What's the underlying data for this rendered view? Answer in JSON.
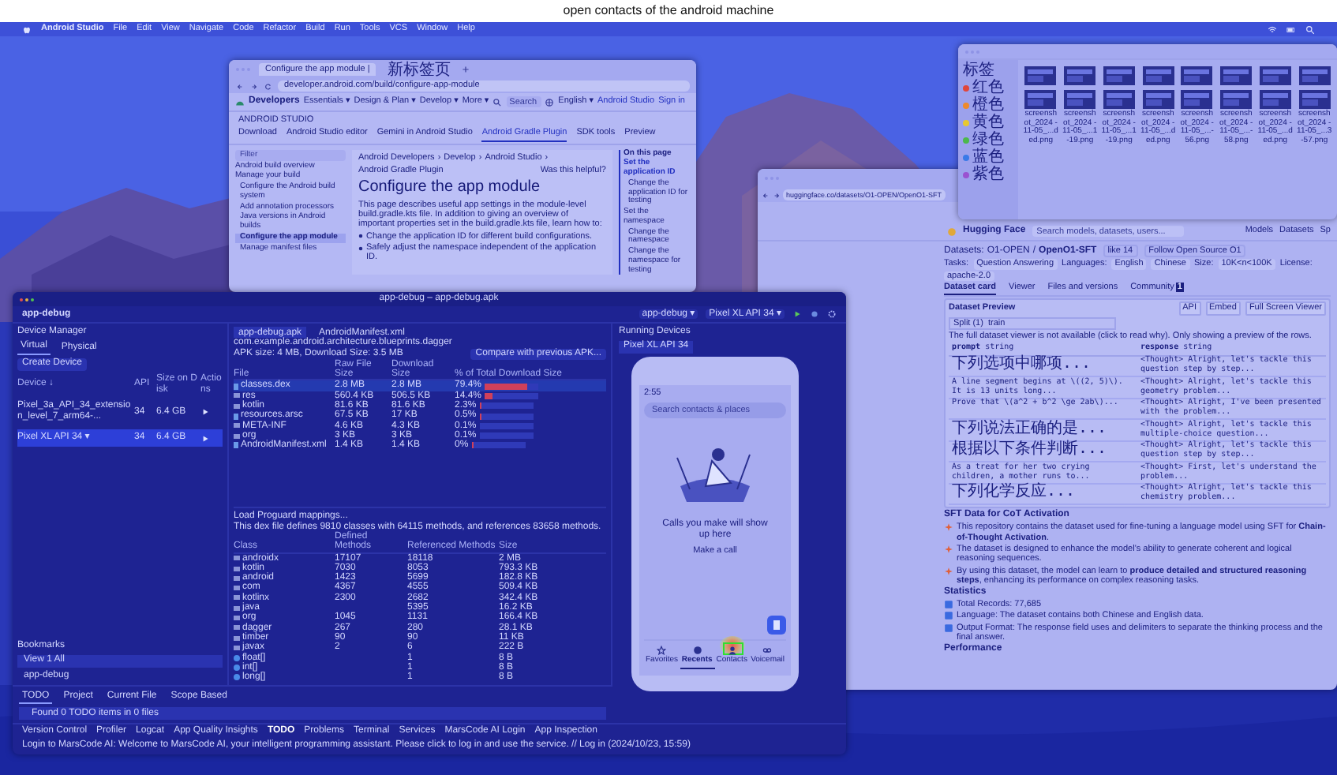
{
  "caption": "open contacts of the android machine",
  "menubar": {
    "app": "Android Studio",
    "items": [
      "File",
      "Edit",
      "View",
      "Navigate",
      "Code",
      "Refactor",
      "Build",
      "Run",
      "Tools",
      "VCS",
      "Window",
      "Help"
    ]
  },
  "dev": {
    "tabs": [
      {
        "label": "Configure the app module |",
        "selected": true
      },
      {
        "label": "新标签页",
        "selected": false
      }
    ],
    "url": "developer.android.com/build/configure-app-module",
    "brand": "Developers",
    "nav": [
      "Essentials ▾",
      "Design & Plan ▾",
      "Develop ▾",
      "More ▾"
    ],
    "search": {
      "placeholder": "Search"
    },
    "language": "English ▾",
    "actions": [
      "Android Studio",
      "Sign in"
    ],
    "section": "ANDROID STUDIO",
    "subtabs": [
      {
        "label": "Download",
        "selected": false
      },
      {
        "label": "Android Studio editor",
        "selected": false
      },
      {
        "label": "Gemini in Android Studio",
        "selected": false
      },
      {
        "label": "Android Gradle Plugin",
        "selected": true
      },
      {
        "label": "SDK tools",
        "selected": false
      },
      {
        "label": "Preview",
        "selected": false
      }
    ],
    "filter": {
      "placeholder": "Filter"
    },
    "sidebar": [
      {
        "label": "Android build overview",
        "kind": "section",
        "selected": false
      },
      {
        "label": "Manage your build",
        "kind": "section",
        "selected": false
      },
      {
        "label": "Configure the Android build system",
        "kind": "page",
        "selected": false
      },
      {
        "label": "Add annotation processors",
        "kind": "page",
        "selected": false
      },
      {
        "label": "Java versions in Android builds",
        "kind": "page",
        "selected": false
      },
      {
        "label": "Configure the app module",
        "kind": "page",
        "selected": true
      },
      {
        "label": "Manage manifest files",
        "kind": "page",
        "selected": false
      }
    ],
    "breadcrumb": [
      "Android Developers",
      "›",
      "Develop",
      "›",
      "Android Studio",
      "›",
      "Android Gradle Plugin"
    ],
    "helpful": "Was this helpful?",
    "title": "Configure the app module",
    "intro": "This page describes useful app settings in the module-level build.gradle.kts file. In addition to giving an overview of important properties set in the build.gradle.kts file, learn how to:",
    "bullets": [
      "Change the application ID for different build configurations.",
      "Safely adjust the namespace independent of the application ID."
    ],
    "toc_title": "On this page",
    "toc": [
      {
        "label": "Set the application ID",
        "kind": "section",
        "selected": true
      },
      {
        "label": "Change the application ID for testing",
        "kind": "sub",
        "selected": false
      },
      {
        "label": "Set the namespace",
        "kind": "section",
        "selected": false
      },
      {
        "label": "Change the namespace",
        "kind": "sub",
        "selected": false
      },
      {
        "label": "Change the namespace for testing",
        "kind": "sub",
        "selected": false
      }
    ]
  },
  "finder": {
    "tags_header": "标签",
    "tags": [
      {
        "label": "红色",
        "color": "#e0463c"
      },
      {
        "label": "橙色",
        "color": "#ee8a2c"
      },
      {
        "label": "黄色",
        "color": "#e8c830"
      },
      {
        "label": "绿色",
        "color": "#4cb84c"
      },
      {
        "label": "蓝色",
        "color": "#3a7ae8"
      },
      {
        "label": "紫色",
        "color": "#9a52d0"
      }
    ],
    "files": [
      "screenshot_2024 -11-05_...ded.png",
      "screenshot_2024 -11-05_...1-19.png",
      "screenshot_2024 -11-05_...1-19.png",
      "screenshot_2024 -11-05_...ded.png",
      "screenshot_2024 -11-05_...-56.png",
      "screenshot_2024 -11-05_...-58.png",
      "screenshot_2024 -11-05_...ded.png",
      "screenshot_2024 -11-05_...3-57.png"
    ]
  },
  "hf": {
    "url": "huggingface.co/datasets/O1-OPEN/OpenO1-SFT",
    "brand": "Hugging Face",
    "search": {
      "placeholder": "Search models, datasets, users..."
    },
    "nav": [
      "Models",
      "Datasets",
      "Sp"
    ],
    "crumb": [
      "Datasets:",
      "O1-OPEN",
      "/",
      "OpenO1-SFT"
    ],
    "like": "like",
    "likes": "14",
    "follow": "Follow",
    "follow_org": "Open Source O1",
    "meta": [
      {
        "label": "Tasks:",
        "values": [
          "Question Answering"
        ]
      },
      {
        "label": "Languages:",
        "values": [
          "English",
          "Chinese"
        ]
      },
      {
        "label": "Size:",
        "values": [
          "10K<n<100K"
        ]
      },
      {
        "label": "License:",
        "values": [
          "apache-2.0"
        ]
      }
    ],
    "tabs": [
      {
        "label": "Dataset card",
        "selected": true
      },
      {
        "label": "Viewer",
        "selected": false
      },
      {
        "label": "Files and versions",
        "selected": false
      },
      {
        "label": "Community",
        "selected": false,
        "badge": "1"
      }
    ],
    "preview": {
      "title": "Dataset Preview",
      "actions": [
        "API",
        "Embed",
        "Full Screen Viewer"
      ],
      "split_label": "Split (1)",
      "split": "train",
      "notice": "The full dataset viewer is not available (click to read why). Only showing a preview of the rows.",
      "columns": [
        {
          "name": "prompt",
          "type": "string"
        },
        {
          "name": "response",
          "type": "string"
        }
      ],
      "rows": [
        {
          "kind": "cjk",
          "prompt": "下列选项中哪项...",
          "response": "<Thought> Alright, let's tackle this question step by step..."
        },
        {
          "kind": "latin",
          "prompt": "A line segment begins at \\((2, 5)\\). It is 13 units long...",
          "response": "<Thought> Alright, let's tackle this geometry problem..."
        },
        {
          "kind": "latin",
          "prompt": "Prove that \\(a^2 + b^2 \\ge 2ab\\)...",
          "response": "<Thought> Alright, I've been presented with the problem..."
        },
        {
          "kind": "cjk",
          "prompt": "下列说法正确的是...",
          "response": "<Thought> Alright, let's tackle this multiple-choice question..."
        },
        {
          "kind": "cjk",
          "prompt": "根据以下条件判断...",
          "response": "<Thought> Alright, let's tackle this question step by step..."
        },
        {
          "kind": "latin",
          "prompt": "As a treat for her two crying children, a mother runs to...",
          "response": "<Thought> First, let's understand the problem..."
        },
        {
          "kind": "cjk",
          "prompt": "下列化学反应...",
          "response": "<Thought> Alright, let's tackle this chemistry problem..."
        }
      ]
    },
    "heading": "SFT Data for CoT Activation",
    "paragraphs": [
      "This repository contains the dataset used for fine-tuning a language model using SFT for **Chain-of-Thought Activation**.",
      "The dataset is designed to enhance the model's ability to generate coherent and logical reasoning sequences.",
      "By using this dataset, the model can learn to **produce detailed and structured reasoning steps**, enhancing its performance on complex reasoning tasks."
    ],
    "stats_heading": "Statistics",
    "stats": [
      "Total Records: 77,685",
      "Language: The dataset contains both Chinese and English data.",
      "Output Format: The response field uses and delimiters to separate the thinking process and the final answer."
    ],
    "perf_heading": "Performance"
  },
  "as": {
    "title": "app-debug – app-debug.apk",
    "project": "app-debug",
    "run_config": "app-debug ▾",
    "device": "Pixel XL API 34 ▾",
    "devmgr": {
      "title": "Device Manager",
      "tabs": [
        {
          "label": "Virtual",
          "selected": true
        },
        {
          "label": "Physical",
          "selected": false
        }
      ],
      "create": "Create Device",
      "columns": [
        "Device ↓",
        "API",
        "Size on Disk",
        "Actions"
      ],
      "rows": [
        {
          "name": "Pixel_3a_API_34_extension_level_7_arm64-...",
          "api": "34",
          "size": "6.4 GB",
          "selected": false
        },
        {
          "name": "Pixel XL API 34 ▾",
          "api": "34",
          "size": "6.4 GB",
          "selected": true
        }
      ]
    },
    "bookmarks": {
      "title": "Bookmarks",
      "items": [
        {
          "label": "View 1 All",
          "selected": true
        },
        {
          "label": "app-debug",
          "selected": false
        }
      ]
    },
    "apk": {
      "tabs": [
        {
          "label": "app-debug.apk",
          "selected": true
        },
        {
          "label": "AndroidManifest.xml",
          "selected": false
        }
      ],
      "package": "com.example.android.architecture.blueprints.dagger",
      "size": "APK size: 4 MB, Download Size: 3.5 MB",
      "compare": "Compare with previous APK...",
      "columns": [
        "File",
        "Raw File Size",
        "Download Size",
        "% of Total Download Size"
      ],
      "rows": [
        {
          "name": "classes.dex",
          "kind": "file",
          "raw": "2.8 MB",
          "download": "2.8 MB",
          "percent": "79.4%",
          "level": 0.794
        },
        {
          "name": "res",
          "kind": "folder",
          "raw": "560.4 KB",
          "download": "506.5 KB",
          "percent": "14.4%",
          "level": 0.144
        },
        {
          "name": "kotlin",
          "kind": "folder",
          "raw": "81.6 KB",
          "download": "81.6 KB",
          "percent": "2.3%",
          "level": 0.023
        },
        {
          "name": "resources.arsc",
          "kind": "file",
          "raw": "67.5 KB",
          "download": "17 KB",
          "percent": "0.5%",
          "level": 0.005
        },
        {
          "name": "META-INF",
          "kind": "folder",
          "raw": "4.6 KB",
          "download": "4.3 KB",
          "percent": "0.1%",
          "level": 0.001
        },
        {
          "name": "org",
          "kind": "folder",
          "raw": "3 KB",
          "download": "3 KB",
          "percent": "0.1%",
          "level": 0.001
        },
        {
          "name": "AndroidManifest.xml",
          "kind": "file",
          "raw": "1.4 KB",
          "download": "1.4 KB",
          "percent": "0%",
          "level": 0
        }
      ]
    },
    "dex": {
      "load": "Load Proguard mappings...",
      "summary": "This dex file defines 9810 classes with 64115 methods, and references 83658 methods.",
      "columns": [
        "Class",
        "Defined Methods",
        "Referenced Methods",
        "Size"
      ],
      "rows": [
        {
          "name": "androidx",
          "kind": "package",
          "defined": "17107",
          "referenced": "18118",
          "size": "2 MB"
        },
        {
          "name": "kotlin",
          "kind": "package",
          "defined": "7030",
          "referenced": "8053",
          "size": "793.3 KB"
        },
        {
          "name": "android",
          "kind": "package",
          "defined": "1423",
          "referenced": "5699",
          "size": "182.8 KB"
        },
        {
          "name": "com",
          "kind": "package",
          "defined": "4367",
          "referenced": "4555",
          "size": "509.4 KB"
        },
        {
          "name": "kotlinx",
          "kind": "package",
          "defined": "2300",
          "referenced": "2682",
          "size": "342.4 KB"
        },
        {
          "name": "java",
          "kind": "package",
          "referenced": "5395",
          "size": "16.2 KB"
        },
        {
          "name": "org",
          "kind": "package",
          "defined": "1045",
          "referenced": "1131",
          "size": "166.4 KB"
        },
        {
          "name": "dagger",
          "kind": "package",
          "defined": "267",
          "referenced": "280",
          "size": "28.1 KB"
        },
        {
          "name": "timber",
          "kind": "package",
          "defined": "90",
          "referenced": "90",
          "size": "11 KB"
        },
        {
          "name": "javax",
          "kind": "package",
          "defined": "2",
          "referenced": "6",
          "size": "222 B"
        },
        {
          "name": "float[]",
          "kind": "class",
          "referenced": "1",
          "size": "8 B"
        },
        {
          "name": "int[]",
          "kind": "class",
          "referenced": "1",
          "size": "8 B"
        },
        {
          "name": "long[]",
          "kind": "class",
          "referenced": "1",
          "size": "8 B"
        }
      ]
    },
    "running": {
      "title": "Running Devices",
      "device": "Pixel XL API 34"
    },
    "phone": {
      "time": "2:55",
      "search": {
        "placeholder": "Search contacts & places"
      },
      "empty": "Calls you make will show up here",
      "action": "Make a call",
      "nav": [
        {
          "label": "Favorites",
          "kind": "star",
          "selected": false
        },
        {
          "label": "Recents",
          "kind": "clock",
          "selected": true
        },
        {
          "label": "Contacts",
          "kind": "people",
          "selected": false
        },
        {
          "label": "Voicemail",
          "kind": "voicemail",
          "selected": false
        }
      ]
    },
    "todo": {
      "tabs": [
        {
          "label": "TODO",
          "selected": true
        },
        {
          "label": "Project",
          "selected": false
        },
        {
          "label": "Current File",
          "selected": false
        },
        {
          "label": "Scope Based",
          "selected": false
        }
      ],
      "found": "Found 0 TODO items in 0 files"
    },
    "toolwindows": [
      {
        "label": "Version Control",
        "selected": false
      },
      {
        "label": "Profiler",
        "selected": false
      },
      {
        "label": "Logcat",
        "selected": false
      },
      {
        "label": "App Quality Insights",
        "selected": false
      },
      {
        "label": "TODO",
        "selected": true
      },
      {
        "label": "Problems",
        "selected": false
      },
      {
        "label": "Terminal",
        "selected": false
      },
      {
        "label": "Services",
        "selected": false
      },
      {
        "label": "MarsCode AI Login",
        "selected": false
      },
      {
        "label": "App Inspection",
        "selected": false
      }
    ],
    "status": "Login to MarsCode AI: Welcome to MarsCode AI, your intelligent programming assistant. Please click to log in and use the service. // Log in (2024/10/23, 15:59)"
  }
}
